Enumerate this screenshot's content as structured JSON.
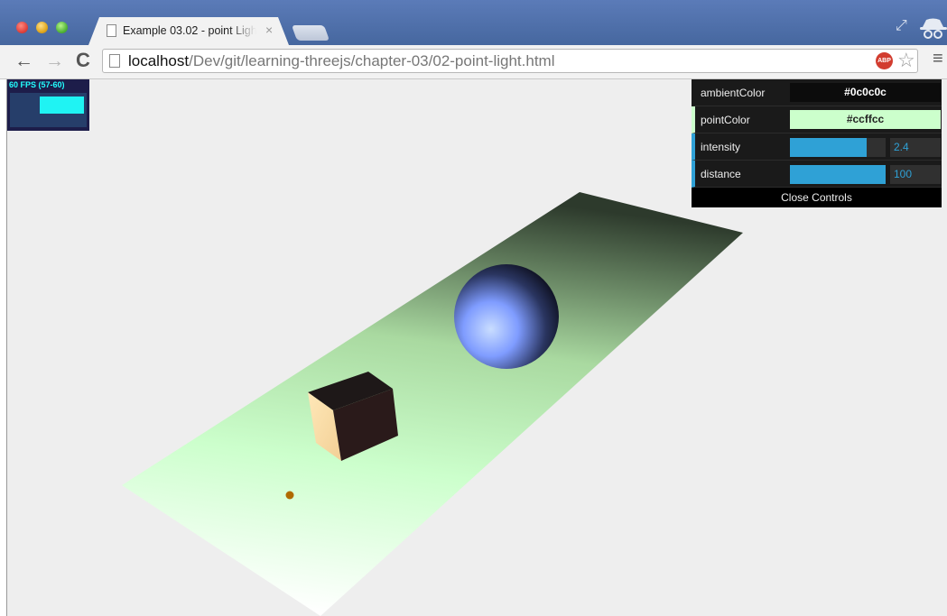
{
  "tab": {
    "title": "Example 03.02 - point Light",
    "close": "×"
  },
  "toolbar": {
    "back": "←",
    "forward": "→",
    "reload": "C",
    "url_host": "localhost",
    "url_path": "/Dev/git/learning-threejs/chapter-03/02-point-light.html",
    "adblock_label": "ABP",
    "star": "☆",
    "menu": "≡",
    "resize": "⤢"
  },
  "stats": {
    "fps_text": "60 FPS (57-60)",
    "fps": 60,
    "fps_min": 57,
    "fps_max": 60
  },
  "gui": {
    "ambientColor": {
      "label": "ambientColor",
      "value": "#0c0c0c"
    },
    "pointColor": {
      "label": "pointColor",
      "value": "#ccffcc"
    },
    "intensity": {
      "label": "intensity",
      "value": "2.4",
      "fraction": 0.8
    },
    "distance": {
      "label": "distance",
      "value": "100",
      "fraction": 1.0
    },
    "close_label": "Close Controls"
  },
  "scene": {
    "background": "#eeeeee",
    "plane_colors": [
      "#2d3a2c",
      "#a9d9a0",
      "#ccffcc",
      "#ffffff"
    ],
    "sphere_color": "#7799ff",
    "cube_lit_color": "#ffe8b8",
    "cube_dark_color": "#2a1a1a",
    "light_marker_color": "#b06a00"
  }
}
